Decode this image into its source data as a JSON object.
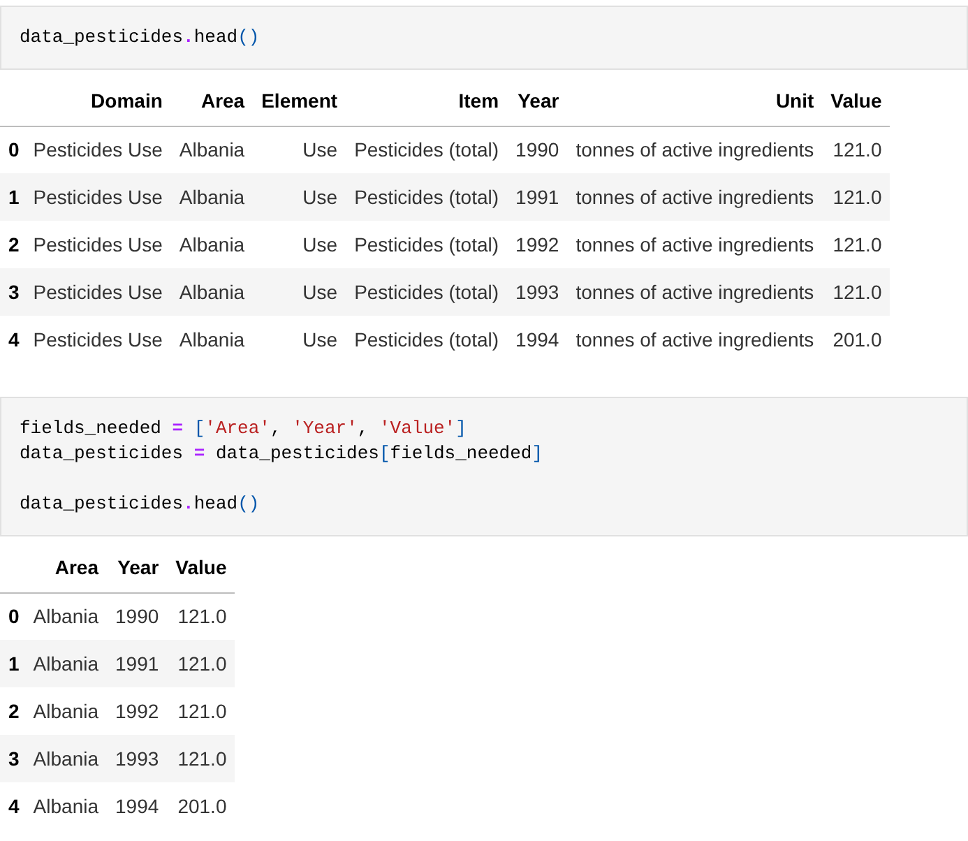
{
  "cells": [
    {
      "code": [
        {
          "lines": [
            [
              {
                "kind": "name",
                "t": "data_pesticides"
              },
              {
                "kind": "op",
                "t": "."
              },
              {
                "kind": "name",
                "t": "head"
              },
              {
                "kind": "punct",
                "t": "()"
              }
            ]
          ]
        }
      ],
      "table": {
        "columns": [
          "Domain",
          "Area",
          "Element",
          "Item",
          "Year",
          "Unit",
          "Value"
        ],
        "rows": [
          {
            "index": "0",
            "values": [
              "Pesticides Use",
              "Albania",
              "Use",
              "Pesticides (total)",
              "1990",
              "tonnes of active ingredients",
              "121.0"
            ]
          },
          {
            "index": "1",
            "values": [
              "Pesticides Use",
              "Albania",
              "Use",
              "Pesticides (total)",
              "1991",
              "tonnes of active ingredients",
              "121.0"
            ]
          },
          {
            "index": "2",
            "values": [
              "Pesticides Use",
              "Albania",
              "Use",
              "Pesticides (total)",
              "1992",
              "tonnes of active ingredients",
              "121.0"
            ]
          },
          {
            "index": "3",
            "values": [
              "Pesticides Use",
              "Albania",
              "Use",
              "Pesticides (total)",
              "1993",
              "tonnes of active ingredients",
              "121.0"
            ]
          },
          {
            "index": "4",
            "values": [
              "Pesticides Use",
              "Albania",
              "Use",
              "Pesticides (total)",
              "1994",
              "tonnes of active ingredients",
              "201.0"
            ]
          }
        ]
      }
    },
    {
      "code": [
        {
          "lines": [
            [
              {
                "kind": "name",
                "t": "fields_needed "
              },
              {
                "kind": "op",
                "t": "="
              },
              {
                "kind": "punct",
                "t": " ["
              },
              {
                "kind": "string",
                "t": "'Area'"
              },
              {
                "kind": "name",
                "t": ", "
              },
              {
                "kind": "string",
                "t": "'Year'"
              },
              {
                "kind": "name",
                "t": ", "
              },
              {
                "kind": "string",
                "t": "'Value'"
              },
              {
                "kind": "punct",
                "t": "]"
              }
            ],
            [
              {
                "kind": "name",
                "t": "data_pesticides "
              },
              {
                "kind": "op",
                "t": "="
              },
              {
                "kind": "name",
                "t": " data_pesticides"
              },
              {
                "kind": "punct",
                "t": "["
              },
              {
                "kind": "name",
                "t": "fields_needed"
              },
              {
                "kind": "punct",
                "t": "]"
              }
            ]
          ]
        },
        {
          "lines": [
            [
              {
                "kind": "name",
                "t": "data_pesticides"
              },
              {
                "kind": "op",
                "t": "."
              },
              {
                "kind": "name",
                "t": "head"
              },
              {
                "kind": "punct",
                "t": "()"
              }
            ]
          ]
        }
      ],
      "table": {
        "columns": [
          "Area",
          "Year",
          "Value"
        ],
        "rows": [
          {
            "index": "0",
            "values": [
              "Albania",
              "1990",
              "121.0"
            ]
          },
          {
            "index": "1",
            "values": [
              "Albania",
              "1991",
              "121.0"
            ]
          },
          {
            "index": "2",
            "values": [
              "Albania",
              "1992",
              "121.0"
            ]
          },
          {
            "index": "3",
            "values": [
              "Albania",
              "1993",
              "121.0"
            ]
          },
          {
            "index": "4",
            "values": [
              "Albania",
              "1994",
              "201.0"
            ]
          }
        ]
      }
    }
  ]
}
